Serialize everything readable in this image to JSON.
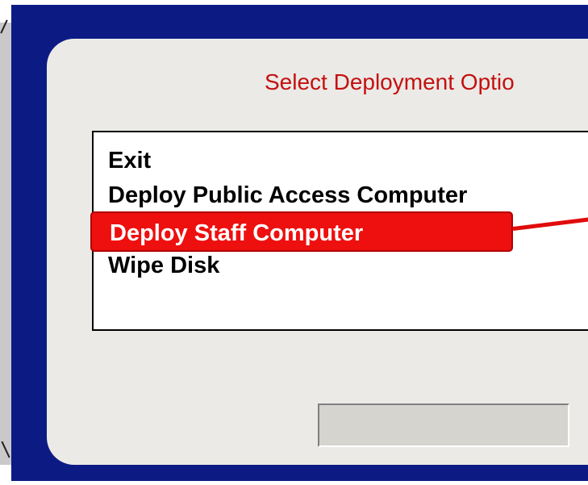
{
  "dialog": {
    "title": "Select Deployment Optio",
    "options": [
      {
        "label": "Exit",
        "selected": false
      },
      {
        "label": "Deploy Public Access Computer",
        "selected": false
      },
      {
        "label": "Deploy Staff Computer",
        "selected": true
      },
      {
        "label": "Wipe Disk",
        "selected": false
      }
    ],
    "button_label": ""
  },
  "colors": {
    "frame": "#0c1b84",
    "dialog_bg": "#ebeae6",
    "title_red": "#c41010",
    "selection_red": "#ee0f0f"
  }
}
